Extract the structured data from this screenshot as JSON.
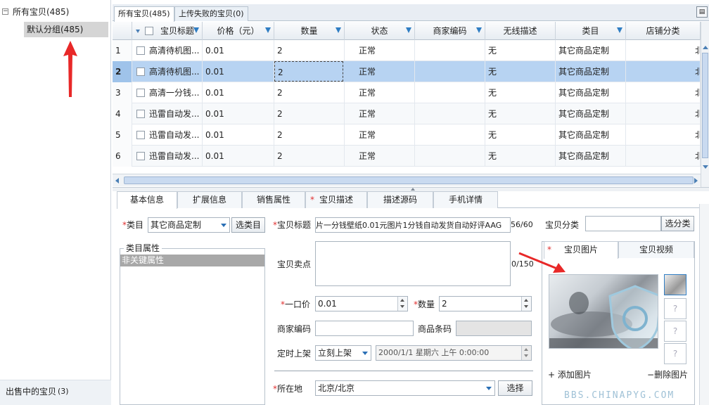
{
  "tree": {
    "root_label": "所有宝贝(485)",
    "default_group": "默认分组(485)",
    "on_sale_label": "出售中的宝贝",
    "on_sale_count": "(3)"
  },
  "top_tabs": [
    {
      "label": "所有宝贝(485)",
      "active": true
    },
    {
      "label": "上传失败的宝贝(0)",
      "active": false
    }
  ],
  "grid": {
    "columns": [
      "宝贝标题",
      "价格（元）",
      "数量",
      "状态",
      "商家编码",
      "无线描述",
      "类目",
      "店铺分类"
    ],
    "rows": [
      {
        "num": "1",
        "title": "高清待机图...",
        "price": "0.01",
        "qty": "2",
        "status": "正常",
        "code": "",
        "wireless": "无",
        "category": "其它商品定制",
        "shop": "北"
      },
      {
        "num": "2",
        "title": "高清待机图...",
        "price": "0.01",
        "qty": "2",
        "status": "正常",
        "code": "",
        "wireless": "无",
        "category": "其它商品定制",
        "shop": "北"
      },
      {
        "num": "3",
        "title": "高清一分钱...",
        "price": "0.01",
        "qty": "2",
        "status": "正常",
        "code": "",
        "wireless": "无",
        "category": "其它商品定制",
        "shop": "北"
      },
      {
        "num": "4",
        "title": "迅雷自动发...",
        "price": "0.01",
        "qty": "2",
        "status": "正常",
        "code": "",
        "wireless": "无",
        "category": "其它商品定制",
        "shop": "北"
      },
      {
        "num": "5",
        "title": "迅雷自动发...",
        "price": "0.01",
        "qty": "2",
        "status": "正常",
        "code": "",
        "wireless": "无",
        "category": "其它商品定制",
        "shop": "北"
      },
      {
        "num": "6",
        "title": "迅雷自动发...",
        "price": "0.01",
        "qty": "2",
        "status": "正常",
        "code": "",
        "wireless": "无",
        "category": "其它商品定制",
        "shop": "北"
      }
    ]
  },
  "bottom_tabs": [
    "基本信息",
    "扩展信息",
    "销售属性",
    "宝贝描述",
    "描述源码",
    "手机详情"
  ],
  "form": {
    "category_label": "类目",
    "category_value": "其它商品定制",
    "select_category_btn": "选类目",
    "title_label": "宝贝标题",
    "title_value": "片一分钱壁纸0.01元图片1分钱自动发货自动好评AAG",
    "title_count": "56/60",
    "shop_cat_label": "宝贝分类",
    "shop_cat_value": "",
    "select_shop_cat_btn": "选分类",
    "cat_attr_legend": "类目属性",
    "non_key_attr": "非关键属性",
    "selling_point_label": "宝贝卖点",
    "selling_point_value": "",
    "selling_point_count": "0/150",
    "price_label": "一口价",
    "price_value": "0.01",
    "qty_label": "数量",
    "qty_value": "2",
    "merchant_code_label": "商家编码",
    "merchant_code_value": "",
    "barcode_label": "商品条码",
    "barcode_value": "",
    "schedule_label": "定时上架",
    "schedule_mode": "立刻上架",
    "schedule_datetime": "2000/1/1 星期六 上午 0:00:00",
    "location_label": "所在地",
    "location_value": "北京/北京",
    "location_btn": "选择"
  },
  "images": {
    "tabs": [
      "宝贝图片",
      "宝贝视频"
    ],
    "add_label": "添加图片",
    "delete_label": "删除图片",
    "placeholder": "?"
  },
  "watermark": "BBS.CHINAPYG.COM",
  "colors": {
    "selected_row": "#b7d3f2",
    "required_star": "#e03030",
    "filter_icon": "#2f7dc3",
    "arrow": "#e82828"
  }
}
